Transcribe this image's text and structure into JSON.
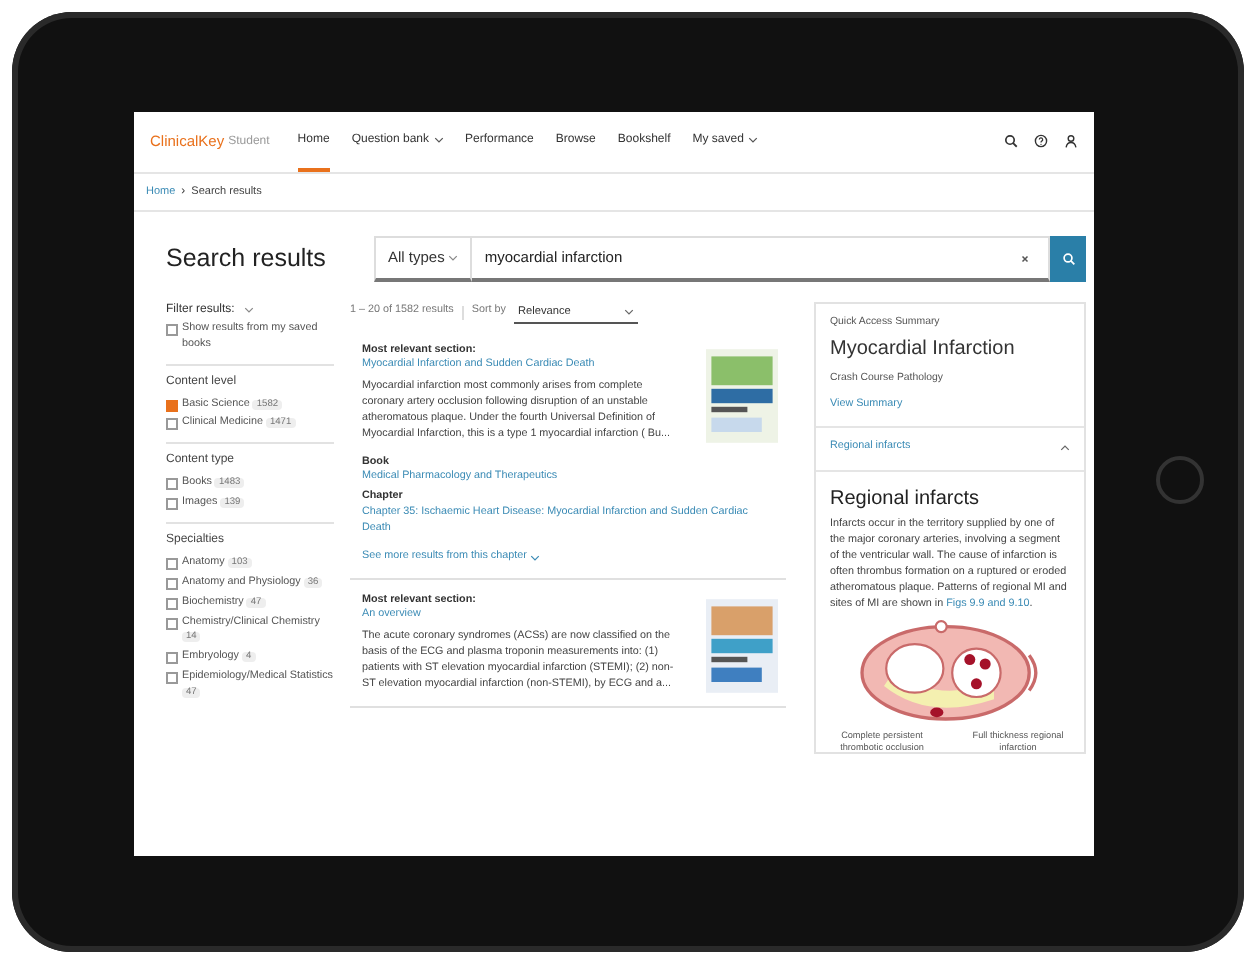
{
  "app": {
    "logo": "ClinicalKey",
    "logo_suffix": "Student"
  },
  "nav": [
    {
      "label": "Home",
      "selected": true,
      "dropdown": false
    },
    {
      "label": "Question bank",
      "selected": false,
      "dropdown": true
    },
    {
      "label": "Performance",
      "selected": false,
      "dropdown": false
    },
    {
      "label": "Browse",
      "selected": false,
      "dropdown": false
    },
    {
      "label": "Bookshelf",
      "selected": false,
      "dropdown": false
    },
    {
      "label": "My saved",
      "selected": false,
      "dropdown": true
    }
  ],
  "breadcrumb": {
    "items": [
      "Home",
      "Search results"
    ],
    "separator": "›"
  },
  "page_title": "Search results",
  "search": {
    "type": "All types",
    "value": "myocardial infarction"
  },
  "filters": {
    "title": "Filter results:",
    "saved_books": {
      "label": "Show results from my saved books",
      "checked": false
    },
    "groups": [
      {
        "title": "Content level",
        "options": [
          {
            "label": "Basic Science",
            "count": "1582",
            "checked": true
          },
          {
            "label": "Clinical Medicine",
            "count": "1471",
            "checked": false
          }
        ]
      },
      {
        "title": "Content type",
        "options": [
          {
            "label": "Books",
            "count": "1483",
            "checked": false
          },
          {
            "label": "Images",
            "count": "139",
            "checked": false
          }
        ]
      },
      {
        "title": "Specialties",
        "options": [
          {
            "label": "Anatomy",
            "count": "103",
            "checked": false
          },
          {
            "label": "Anatomy and Physiology",
            "count": "36",
            "checked": false
          },
          {
            "label": "Biochemistry",
            "count": "47",
            "checked": false
          },
          {
            "label": "Chemistry/Clinical Chemistry",
            "count": "14",
            "checked": false
          },
          {
            "label": "Embryology",
            "count": "4",
            "checked": false
          },
          {
            "label": "Epidemiology/Medical Statistics",
            "count": "47",
            "checked": false
          }
        ]
      }
    ]
  },
  "results": {
    "summary": "1 – 20 of 1582 results",
    "sort_label": "Sort by",
    "sort_value": "Relevance",
    "items": [
      {
        "heading": "Most relevant section:",
        "link": "Myocardial Infarction and Sudden Cardiac Death",
        "snippet": "Myocardial infarction most commonly arises from complete coronary artery occlusion following disruption of an unstable atheromatous plaque. Under the fourth Universal Definition of Myocardial Infarction, this is a type 1 myocardial infarction ( Bu...",
        "book_label": "Book",
        "book": "Medical Pharmacology and Therapeutics",
        "chapter_label": "Chapter",
        "chapter": "Chapter 35: Ischaemic Heart Disease: Myocardial Infarction and Sudden Cardiac Death",
        "more": "See more results from this chapter"
      },
      {
        "heading": "Most relevant section:",
        "link": "An overview",
        "snippet": "The acute coronary syndromes (ACSs) are now classified on the basis of the ECG and plasma troponin measurements into: (1) patients with ST elevation myocardial infarction (STEMI); (2) non-ST elevation myocardial infarction (non-STEMI), by ECG and a..."
      }
    ]
  },
  "quick_access": {
    "label": "Quick Access Summary",
    "title": "Myocardial Infarction",
    "subtitle": "Crash Course Pathology",
    "view": "View Summary",
    "section": {
      "label": "Regional infarcts",
      "expanded": true
    },
    "heading": "Regional infarcts",
    "text": "Infarcts occur in the territory supplied by one of the major coronary arteries, involving a segment of the ventricular wall. The cause of infarction is often thrombus formation on a ruptured or eroded atheromatous plaque. Patterns of regional MI and sites of MI are shown in ",
    "link": "Figs 9.9 and 9.10",
    "after": ".",
    "figure_labels": [
      "Complete persistent thrombotic occlusion",
      "Full thickness regional infarction"
    ]
  }
}
